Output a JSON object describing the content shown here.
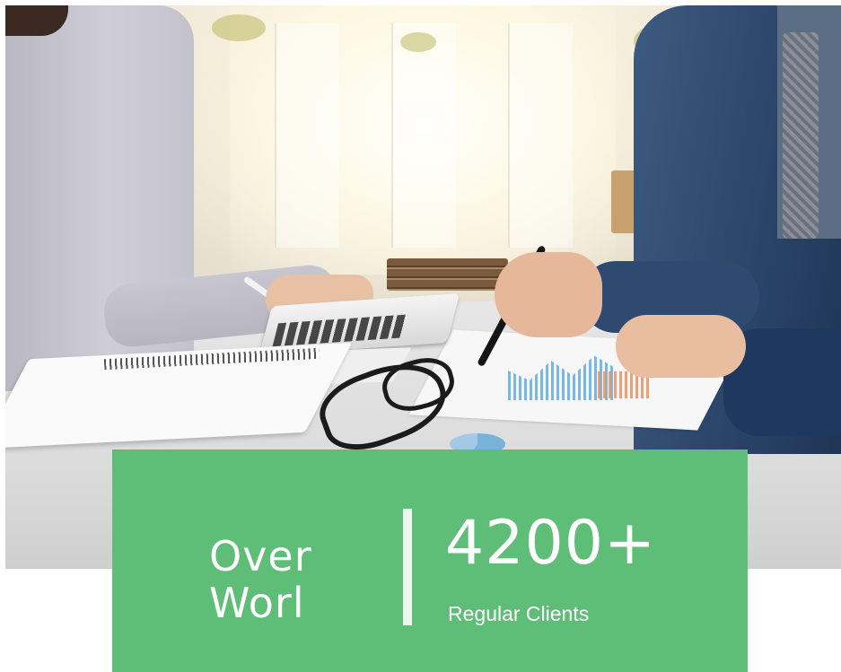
{
  "photo": {
    "subject": "business-meeting-photo"
  },
  "stats": {
    "left_line_1": "Over",
    "left_line_2": "Worl",
    "number": "4200+",
    "caption": "Regular Clients"
  },
  "colors": {
    "card_background": "#5ebd76",
    "card_text": "#ffffff",
    "divider": "#ffffff"
  }
}
